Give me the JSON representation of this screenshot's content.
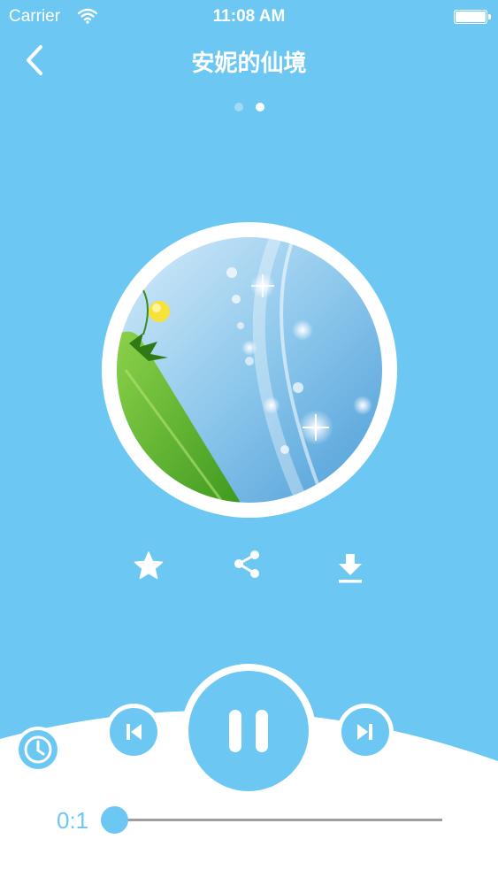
{
  "status_bar": {
    "carrier": "Carrier",
    "time": "11:08 AM"
  },
  "nav": {
    "title": "安妮的仙境",
    "back_icon": "chevron-left-icon"
  },
  "pager": {
    "count": 2,
    "active_index": 1
  },
  "album_art": {
    "description_icon": "album-cover-image"
  },
  "actions": [
    {
      "name": "favorite",
      "icon": "star-icon"
    },
    {
      "name": "share",
      "icon": "share-icon"
    },
    {
      "name": "download",
      "icon": "download-icon"
    }
  ],
  "player": {
    "current_time": "0:1",
    "progress": 0.0,
    "state": "playing",
    "controls": [
      "timer",
      "previous",
      "pause",
      "next"
    ]
  },
  "colors": {
    "accent": "#6cc8f3",
    "white": "#ffffff",
    "track": "#9e9e9e"
  }
}
